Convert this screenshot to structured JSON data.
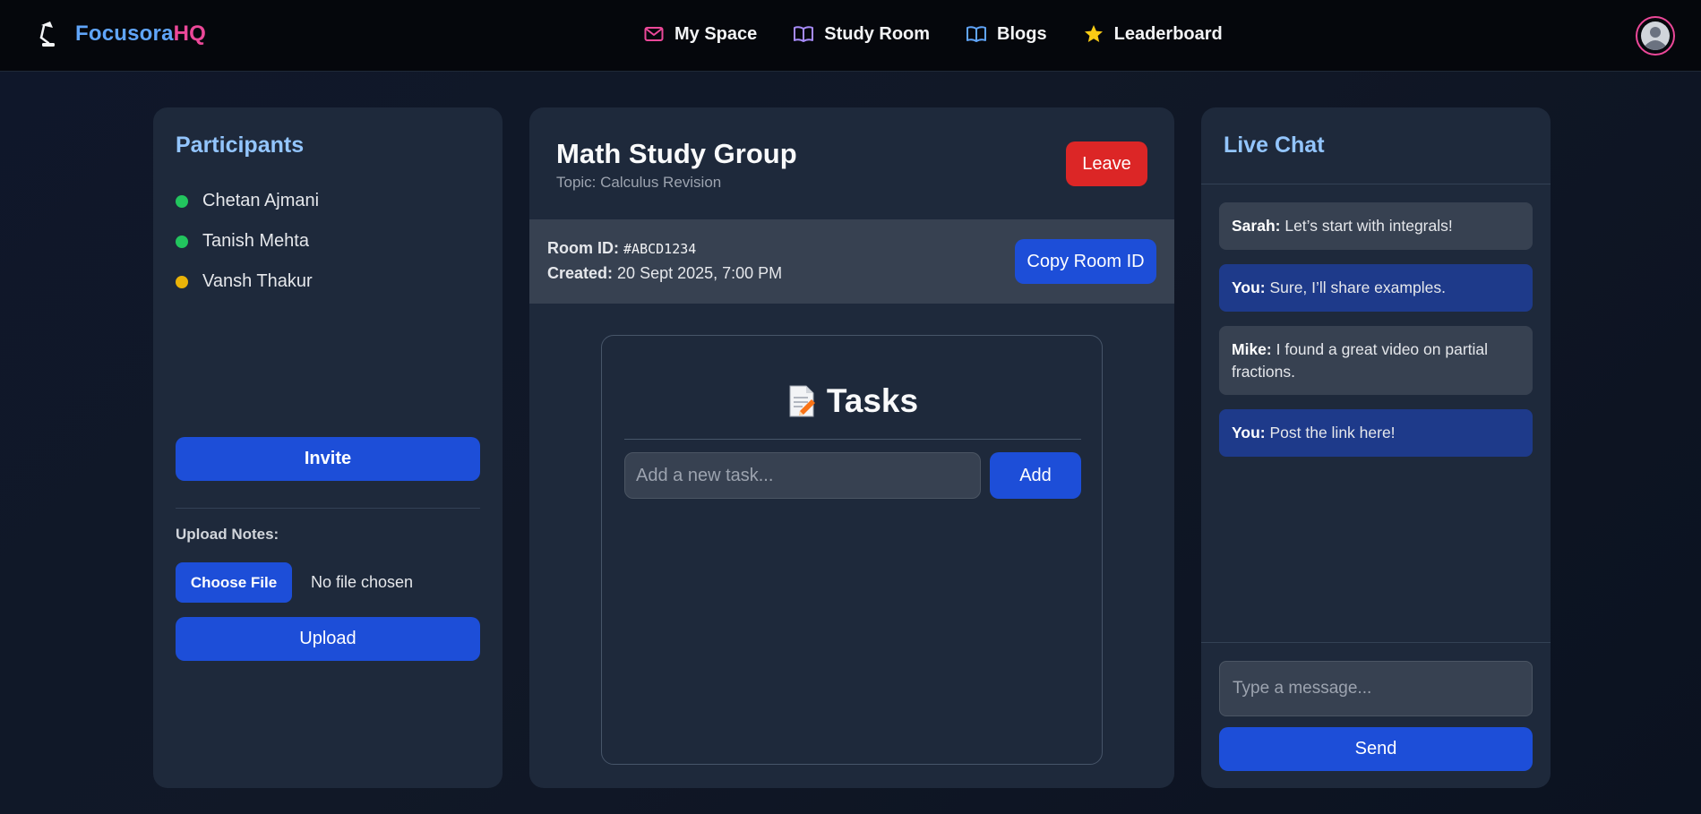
{
  "navbar": {
    "brand_part1": "Focusora",
    "brand_part2": "HQ",
    "links": [
      {
        "label": "My Space",
        "icon": "mail-icon"
      },
      {
        "label": "Study Room",
        "icon": "book-open-icon"
      },
      {
        "label": "Blogs",
        "icon": "book-icon"
      },
      {
        "label": "Leaderboard",
        "icon": "star-icon"
      }
    ],
    "avatar_icon": "user-avatar-icon"
  },
  "participants": {
    "title": "Participants",
    "list": [
      {
        "name": "Chetan Ajmani",
        "status": "online",
        "status_color": "#22c55e"
      },
      {
        "name": "Tanish Mehta",
        "status": "online",
        "status_color": "#22c55e"
      },
      {
        "name": "Vansh Thakur",
        "status": "away",
        "status_color": "#eab308"
      }
    ],
    "invite_label": "Invite",
    "upload_label": "Upload Notes:",
    "choose_file_label": "Choose File",
    "no_file_text": "No file chosen",
    "upload_button_label": "Upload"
  },
  "room": {
    "title": "Math Study Group",
    "topic": "Topic: Calculus Revision",
    "leave_label": "Leave",
    "room_id_label": "Room ID:",
    "room_id": "#ABCD1234",
    "created_label": "Created:",
    "created": "20 Sept 2025, 7:00 PM",
    "copy_label": "Copy Room ID"
  },
  "tasks": {
    "title": "Tasks",
    "icon": "memo-icon",
    "input_placeholder": "Add a new task...",
    "input_value": "",
    "add_label": "Add"
  },
  "chat": {
    "title": "Live Chat",
    "messages": [
      {
        "sender": "Sarah:",
        "text": "Let’s start with integrals!",
        "mine": false
      },
      {
        "sender": "You:",
        "text": "Sure, I’ll share examples.",
        "mine": true
      },
      {
        "sender": "Mike:",
        "text": "I found a great video on partial fractions.",
        "mine": false
      },
      {
        "sender": "You:",
        "text": "Post the link here!",
        "mine": true
      }
    ],
    "input_placeholder": "Type a message...",
    "input_value": "",
    "send_label": "Send"
  },
  "colors": {
    "accent_blue": "#1d4ed8",
    "danger_red": "#dc2626",
    "brand_blue": "#60a5fa",
    "brand_pink": "#ec4899",
    "panel_bg": "#1e293b",
    "heading_blue": "#93c5fd"
  }
}
